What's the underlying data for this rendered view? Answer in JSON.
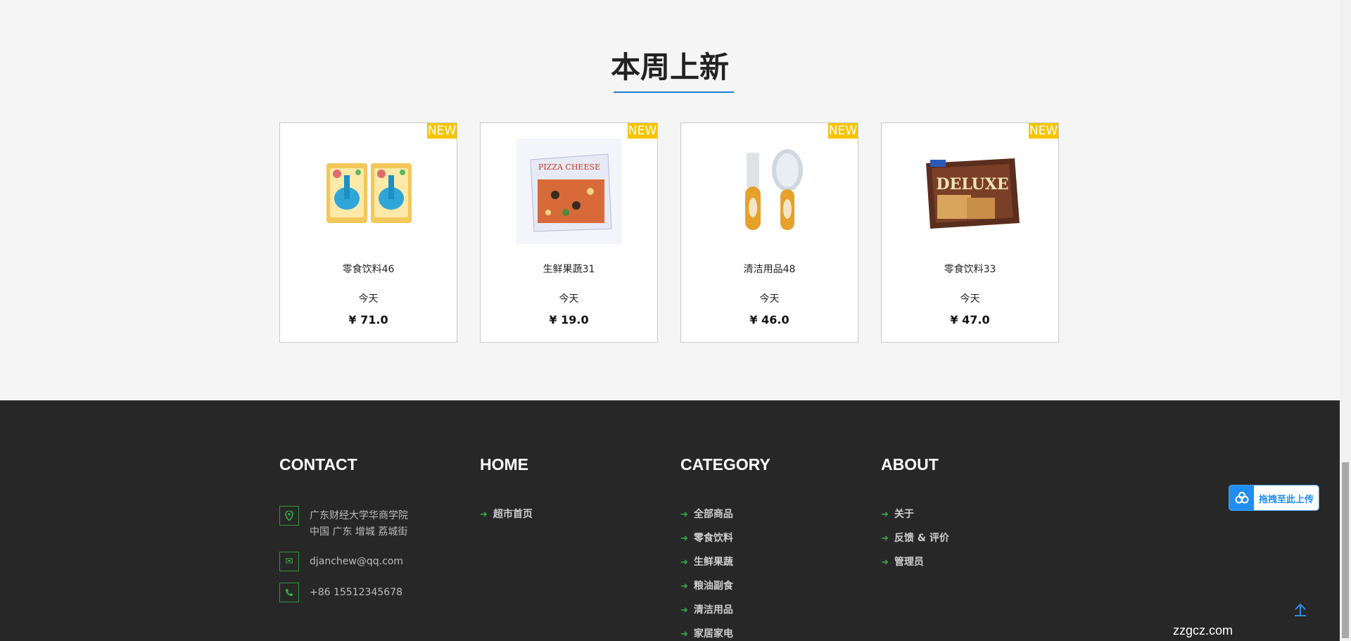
{
  "section": {
    "title": "本周上新"
  },
  "products": [
    {
      "badge": "NEW",
      "name": "零食饮料46",
      "date": "今天",
      "price": "¥ 71.0",
      "image": "toothbrush-pack"
    },
    {
      "badge": "NEW",
      "name": "生鲜果蔬31",
      "date": "今天",
      "price": "¥ 19.0",
      "image": "pizza-cheese-box"
    },
    {
      "badge": "NEW",
      "name": "清洁用品48",
      "date": "今天",
      "price": "¥ 46.0",
      "image": "brush-comb-set"
    },
    {
      "badge": "NEW",
      "name": "零食饮料33",
      "date": "今天",
      "price": "¥ 47.0",
      "image": "deluxe-crackers"
    }
  ],
  "footer": {
    "contact": {
      "title": "CONTACT",
      "address_line1": "广东财经大学华商学院",
      "address_line2": "中国 广东 增城 荔城街",
      "email": "djanchew@qq.com",
      "phone": "+86 15512345678"
    },
    "home": {
      "title": "HOME",
      "links": [
        "超市首页"
      ]
    },
    "category": {
      "title": "CATEGORY",
      "links": [
        "全部商品",
        "零食饮料",
        "生鲜果蔬",
        "粮油副食",
        "清洁用品",
        "家居家电"
      ]
    },
    "about": {
      "title": "ABOUT",
      "links": [
        "关于",
        "反馈 & 评价",
        "管理员"
      ]
    }
  },
  "upload_widget": {
    "label": "拖拽至此上传"
  },
  "watermark": "zzgcz.com",
  "colors": {
    "accent_blue": "#1e7fd0",
    "badge_yellow": "#f5c400",
    "footer_bg": "#272727",
    "link_green": "#2fae3f"
  }
}
